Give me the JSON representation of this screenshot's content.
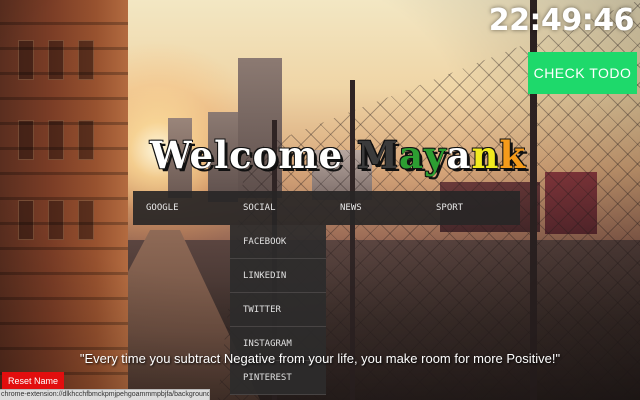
{
  "clock": {
    "time": "22:49:46"
  },
  "todo_button": {
    "label": "CHECK TODO",
    "color": "#1ed96b"
  },
  "welcome": {
    "greeting": "Welcome",
    "name_letters": [
      {
        "char": "M",
        "color": "#3b3b3b"
      },
      {
        "char": "a",
        "color": "#2d9e32"
      },
      {
        "char": "y",
        "color": "#2d9e32"
      },
      {
        "char": "a",
        "color": "#ffffff"
      },
      {
        "char": "n",
        "color": "#f2ea1e"
      },
      {
        "char": "k",
        "color": "#f59b1a"
      }
    ]
  },
  "menu": {
    "items": [
      "GOOGLE",
      "SOCIAL",
      "NEWS",
      "SPORT"
    ],
    "dropdown": [
      "FACEBOOK",
      "LINKEDIN",
      "TWITTER",
      "INSTAGRAM",
      "PINTEREST"
    ]
  },
  "quote": "\"Every time you subtract Negative from your life, you make room for more Positive!\"",
  "reset_button": {
    "label": "Reset Name",
    "color": "#e20e0e"
  },
  "status_url": "chrome-extension://dlkhcchfbmckpmjpehgoammmpbjfa/background.html#1"
}
